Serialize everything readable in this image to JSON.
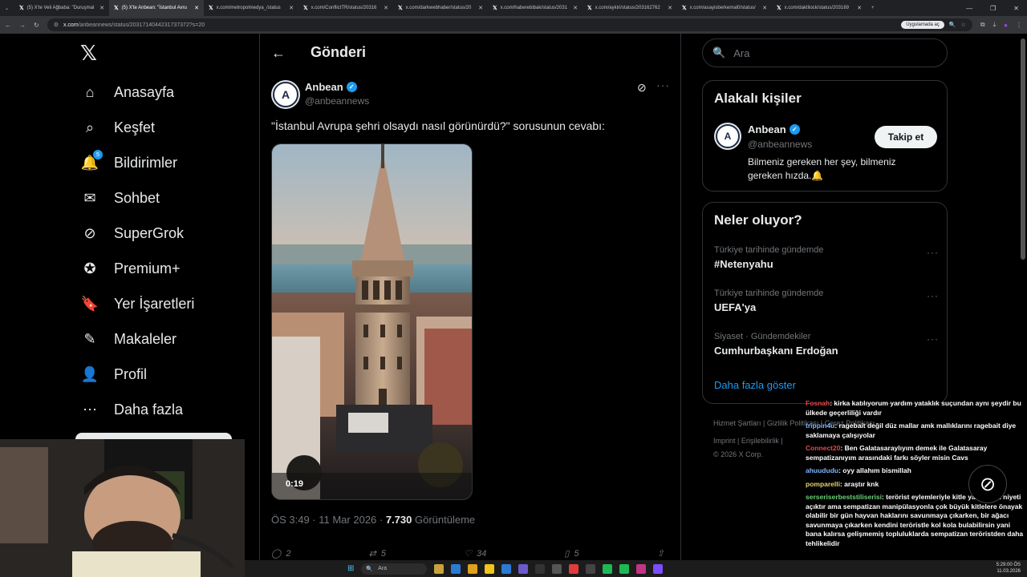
{
  "browser": {
    "tabs": [
      {
        "label": "(5) X'te Veli Ağbaba: \"Duruşmal"
      },
      {
        "label": "(5) X'te Anbean: \"İstanbul Avru",
        "active": true
      },
      {
        "label": "x.com/metropolmedya_/status"
      },
      {
        "label": "x.com/ConflictTR/status/20316"
      },
      {
        "label": "x.com/darkwebhaber/status/20"
      },
      {
        "label": "x.com/haberebibak/status/2031"
      },
      {
        "label": "x.com/aykiri/status/203162762"
      },
      {
        "label": "x.com/asayisberkemal0/status/"
      },
      {
        "label": "x.com/daktilock/status/203169"
      }
    ],
    "url_host": "x.com",
    "url_path": "/anbeannews/status/2031714044231737372?s=20",
    "app_button": "Uygulamada aç"
  },
  "nav": {
    "items": [
      {
        "label": "Anasayfa",
        "icon": "home-icon"
      },
      {
        "label": "Keşfet",
        "icon": "search-icon"
      },
      {
        "label": "Bildirimler",
        "icon": "bell-icon",
        "badge": "5"
      },
      {
        "label": "Sohbet",
        "icon": "mail-icon"
      },
      {
        "label": "SuperGrok",
        "icon": "grok-icon"
      },
      {
        "label": "Premium+",
        "icon": "premium-icon"
      },
      {
        "label": "Yer İşaretleri",
        "icon": "bookmark-icon"
      },
      {
        "label": "Makaleler",
        "icon": "article-icon"
      },
      {
        "label": "Profil",
        "icon": "person-icon"
      },
      {
        "label": "Daha fazla",
        "icon": "more-icon"
      }
    ]
  },
  "post": {
    "header_title": "Gönderi",
    "author_name": "Anbean",
    "author_handle": "@anbeannews",
    "text": "\"İstanbul Avrupa şehri olsaydı nasıl görünürdü?\" sorusunun cevabı:",
    "video_time": "0:19",
    "timestamp": "ÖS 3:49 · 11 Mar 2026 · ",
    "views": "7.730",
    "views_label": " Görüntüleme",
    "replies": "2",
    "reposts": "5",
    "likes": "34",
    "bookmarks": "5"
  },
  "search": {
    "placeholder": "Ara"
  },
  "related": {
    "title": "Alakalı kişiler",
    "name": "Anbean",
    "handle": "@anbeannews",
    "follow_label": "Takip et",
    "bio": "Bilmeniz gereken her şey, bilmeniz gereken hızda.🔔"
  },
  "trends": {
    "title": "Neler oluyor?",
    "items": [
      {
        "context": "Türkiye tarihinde gündemde",
        "name": "#Netenyahu"
      },
      {
        "context": "Türkiye tarihinde gündemde",
        "name": "UEFA'ya"
      },
      {
        "context": "Siyaset · Gündemdekiler",
        "name": "Cumhurbaşkanı Erdoğan"
      }
    ],
    "show_more": "Daha fazla göster"
  },
  "footer": {
    "line1": "Hizmet Şartları  |  Gizlilik Politikası  |  Çerez Politikası",
    "line2": "Imprint  |  Erişilebilirlik  |",
    "line3": "© 2026 X Corp."
  },
  "chat": [
    {
      "user": "Fosnah",
      "text": ": kirka katılıyorum yardım yataklık suçundan aynı şeydir bu ülkede geçerliliği vardır",
      "color": "red"
    },
    {
      "user": "trippin4u",
      "text": ": ragebait değil düz mallar amk mallıklarını ragebait diye saklamaya çalışıyolar",
      "color": "blue"
    },
    {
      "user": "Connect20",
      "text": ": Ben Galatasaraylıyım demek ile Galatasaray sempatizanıyım arasındaki farkı söyler misin Cavs",
      "color": "red"
    },
    {
      "user": "ahuududu",
      "text": ": oyy allahım bismillah",
      "color": "blue"
    },
    {
      "user": "pomparelli",
      "text": ": araştır knk",
      "color": "yellow"
    },
    {
      "user": "serseriserbeststiliserisi",
      "text": ": terörist eylemleriyle kitle yaratamaz niyeti açıktır ama sempatizan manipülasyonla çok büyük kitlelere önayak olabilir bir gün hayvan haklarını savunmaya çıkarken, bir ağacı savunmaya çıkarken kendini teröristle kol kola bulabilirsin yani bana kalırsa gelişmemiş topluluklarda sempatizan teröristden daha tehlikelidir",
      "color": "green"
    }
  ],
  "taskbar": {
    "search": "Ara",
    "time": "5:29:00 ÖS",
    "date": "11.03.2026"
  }
}
